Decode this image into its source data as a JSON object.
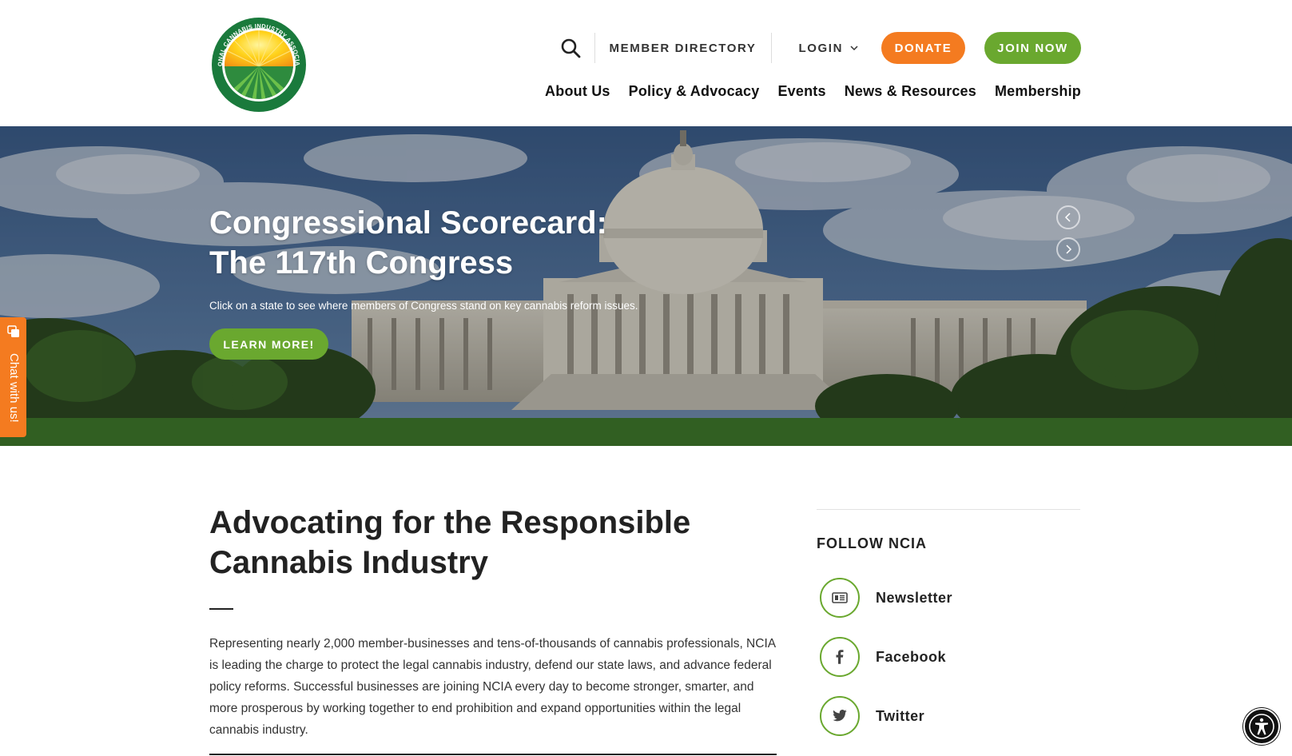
{
  "header": {
    "logo_text": "NATIONAL CANNABIS INDUSTRY ASSOCIATION",
    "util_nav": {
      "member_directory": "MEMBER DIRECTORY",
      "login": "LOGIN",
      "donate": "DONATE",
      "join_now": "JOIN NOW"
    },
    "main_nav": [
      {
        "label": "About Us"
      },
      {
        "label": "Policy & Advocacy"
      },
      {
        "label": "Events"
      },
      {
        "label": "News & Resources"
      },
      {
        "label": "Membership"
      }
    ]
  },
  "hero": {
    "title_line1": "Congressional Scorecard:",
    "title_line2": "The 117th Congress",
    "subtitle": "Click on a state to see where members of Congress stand on key cannabis reform issues.",
    "button": "LEARN MORE!"
  },
  "chat": {
    "label": "Chat with us!"
  },
  "main": {
    "heading_line1": "Advocating for the Responsible",
    "heading_line2": "Cannabis Industry",
    "body": "Representing nearly 2,000 member-businesses and tens-of-thousands of cannabis professionals, NCIA is leading the charge to protect the legal cannabis industry, defend our state laws, and advance federal policy reforms. Successful businesses are joining NCIA every day to become stronger, smarter, and more prosperous by working together to end prohibition and expand opportunities within the legal cannabis industry."
  },
  "sidebar": {
    "follow_title": "FOLLOW NCIA",
    "social": [
      {
        "label": "Newsletter",
        "icon": "newsletter-icon"
      },
      {
        "label": "Facebook",
        "icon": "facebook-icon"
      },
      {
        "label": "Twitter",
        "icon": "twitter-icon"
      }
    ]
  },
  "colors": {
    "orange": "#f47b20",
    "green": "#6aa82f",
    "dark_green": "#1a7a3c"
  }
}
